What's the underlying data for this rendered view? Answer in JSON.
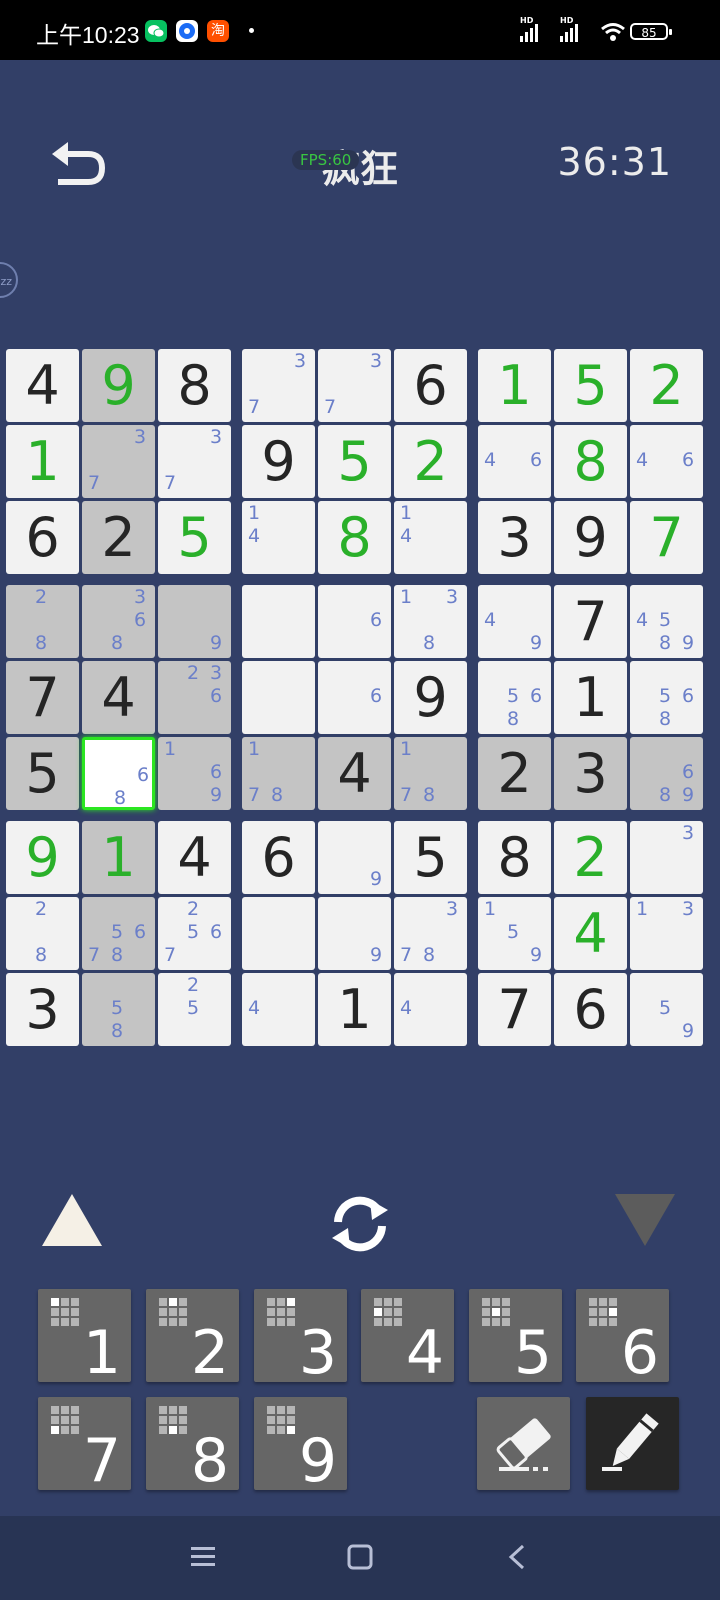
{
  "status_bar": {
    "time": "上午10:23",
    "battery": "85",
    "hd1": "HD",
    "hd2": "HD"
  },
  "header": {
    "fps": "FPS:60",
    "title": "疯狂",
    "timer": "36:31",
    "side_label": "zz"
  },
  "colors": {
    "background": "#323f67",
    "selection": "#2be621",
    "user_digit": "#2ab02a",
    "note_digit": "#6b7fc9"
  },
  "grid": {
    "rows": [
      [
        {
          "v": "4",
          "t": "given",
          "bg": "white"
        },
        {
          "v": "9",
          "t": "user",
          "bg": "grey"
        },
        {
          "v": "8",
          "t": "given",
          "bg": "white"
        },
        {
          "n": [
            3,
            7
          ],
          "bg": "white"
        },
        {
          "n": [
            3,
            7
          ],
          "bg": "white"
        },
        {
          "v": "6",
          "t": "given",
          "bg": "white"
        },
        {
          "v": "1",
          "t": "user",
          "bg": "white"
        },
        {
          "v": "5",
          "t": "user",
          "bg": "white"
        },
        {
          "v": "2",
          "t": "user",
          "bg": "white"
        }
      ],
      [
        {
          "v": "1",
          "t": "user",
          "bg": "white"
        },
        {
          "n": [
            3,
            7
          ],
          "bg": "grey"
        },
        {
          "n": [
            3,
            7
          ],
          "bg": "white"
        },
        {
          "v": "9",
          "t": "given",
          "bg": "white"
        },
        {
          "v": "5",
          "t": "user",
          "bg": "white"
        },
        {
          "v": "2",
          "t": "user",
          "bg": "white"
        },
        {
          "n": [
            4,
            6
          ],
          "bg": "white"
        },
        {
          "v": "8",
          "t": "user",
          "bg": "white"
        },
        {
          "n": [
            4,
            6
          ],
          "bg": "white"
        }
      ],
      [
        {
          "v": "6",
          "t": "given",
          "bg": "white"
        },
        {
          "v": "2",
          "t": "given",
          "bg": "grey"
        },
        {
          "v": "5",
          "t": "user",
          "bg": "white"
        },
        {
          "n": [
            1,
            4
          ],
          "bg": "white"
        },
        {
          "v": "8",
          "t": "user",
          "bg": "white"
        },
        {
          "n": [
            1,
            4
          ],
          "bg": "white"
        },
        {
          "v": "3",
          "t": "given",
          "bg": "white"
        },
        {
          "v": "9",
          "t": "given",
          "bg": "white"
        },
        {
          "v": "7",
          "t": "user",
          "bg": "white"
        }
      ],
      [
        {
          "n": [
            2,
            8
          ],
          "bg": "grey"
        },
        {
          "n": [
            3,
            6,
            8
          ],
          "bg": "grey"
        },
        {
          "n": [
            9
          ],
          "bg": "grey"
        },
        {
          "n": [],
          "bg": "white"
        },
        {
          "n": [
            6
          ],
          "bg": "white"
        },
        {
          "n": [
            1,
            3,
            8
          ],
          "bg": "white"
        },
        {
          "n": [
            4,
            9
          ],
          "bg": "white"
        },
        {
          "v": "7",
          "t": "given",
          "bg": "white"
        },
        {
          "n": [
            4,
            5,
            8,
            9
          ],
          "bg": "white"
        }
      ],
      [
        {
          "v": "7",
          "t": "given",
          "bg": "grey"
        },
        {
          "v": "4",
          "t": "given",
          "bg": "grey"
        },
        {
          "n": [
            2,
            3,
            6
          ],
          "bg": "grey"
        },
        {
          "n": [],
          "bg": "white"
        },
        {
          "n": [
            6
          ],
          "bg": "white"
        },
        {
          "v": "9",
          "t": "given",
          "bg": "white"
        },
        {
          "n": [
            5,
            6,
            8
          ],
          "bg": "white"
        },
        {
          "v": "1",
          "t": "given",
          "bg": "white"
        },
        {
          "n": [
            5,
            6,
            8
          ],
          "bg": "white"
        }
      ],
      [
        {
          "v": "5",
          "t": "given",
          "bg": "grey"
        },
        {
          "n": [
            6,
            8
          ],
          "bg": "sel"
        },
        {
          "n": [
            1,
            6,
            9
          ],
          "bg": "grey"
        },
        {
          "n": [
            1,
            7,
            8
          ],
          "bg": "grey"
        },
        {
          "v": "4",
          "t": "given",
          "bg": "grey"
        },
        {
          "n": [
            1,
            7,
            8
          ],
          "bg": "grey"
        },
        {
          "v": "2",
          "t": "given",
          "bg": "grey"
        },
        {
          "v": "3",
          "t": "given",
          "bg": "grey"
        },
        {
          "n": [
            6,
            8,
            9
          ],
          "bg": "grey"
        }
      ],
      [
        {
          "v": "9",
          "t": "user",
          "bg": "white"
        },
        {
          "v": "1",
          "t": "user",
          "bg": "grey"
        },
        {
          "v": "4",
          "t": "given",
          "bg": "white"
        },
        {
          "v": "6",
          "t": "given",
          "bg": "white"
        },
        {
          "n": [
            9
          ],
          "bg": "white"
        },
        {
          "v": "5",
          "t": "given",
          "bg": "white"
        },
        {
          "v": "8",
          "t": "given",
          "bg": "white"
        },
        {
          "v": "2",
          "t": "user",
          "bg": "white"
        },
        {
          "n": [
            3
          ],
          "bg": "white"
        }
      ],
      [
        {
          "n": [
            2,
            8
          ],
          "bg": "white"
        },
        {
          "n": [
            5,
            6,
            7,
            8
          ],
          "bg": "grey"
        },
        {
          "n": [
            2,
            5,
            6,
            7
          ],
          "bg": "white"
        },
        {
          "n": [],
          "bg": "white"
        },
        {
          "n": [
            9
          ],
          "bg": "white"
        },
        {
          "n": [
            3,
            7,
            8
          ],
          "bg": "white"
        },
        {
          "n": [
            1,
            5,
            9
          ],
          "bg": "white"
        },
        {
          "v": "4",
          "t": "user",
          "bg": "white"
        },
        {
          "n": [
            1,
            3
          ],
          "bg": "white"
        }
      ],
      [
        {
          "v": "3",
          "t": "given",
          "bg": "white"
        },
        {
          "n": [
            5,
            8
          ],
          "bg": "grey"
        },
        {
          "n": [
            2,
            5
          ],
          "bg": "white"
        },
        {
          "n": [
            4
          ],
          "bg": "white"
        },
        {
          "v": "1",
          "t": "given",
          "bg": "white"
        },
        {
          "n": [
            4
          ],
          "bg": "white"
        },
        {
          "v": "7",
          "t": "given",
          "bg": "white"
        },
        {
          "v": "6",
          "t": "given",
          "bg": "white"
        },
        {
          "n": [
            5,
            9
          ],
          "bg": "white"
        }
      ]
    ]
  },
  "keypad": {
    "digits": [
      "1",
      "2",
      "3",
      "4",
      "5",
      "6",
      "7",
      "8",
      "9"
    ]
  },
  "controls": {
    "up_icon": "triangle-up-icon",
    "refresh_icon": "refresh-icon",
    "down_icon": "triangle-down-icon",
    "eraser_icon": "eraser-icon",
    "pencil_icon": "pencil-icon"
  }
}
